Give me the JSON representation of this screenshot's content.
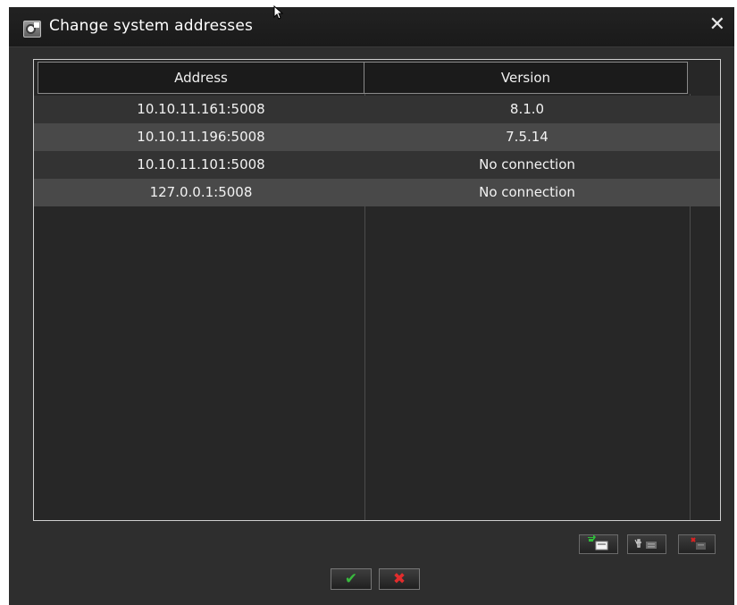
{
  "dialog": {
    "title": "Change system addresses",
    "close_glyph": "✕"
  },
  "table": {
    "columns": [
      "Address",
      "Version"
    ],
    "rows": [
      {
        "address": "10.10.11.161:5008",
        "version": "8.1.0"
      },
      {
        "address": "10.10.11.196:5008",
        "version": "7.5.14"
      },
      {
        "address": "10.10.11.101:5008",
        "version": "No connection"
      },
      {
        "address": "127.0.0.1:5008",
        "version": "No connection"
      }
    ]
  },
  "toolbar": {
    "add_icon": "add-address-icon",
    "edit_icon": "edit-address-icon",
    "delete_icon": "delete-address-icon"
  },
  "actions": {
    "ok_glyph": "✔",
    "cancel_glyph": "✖"
  },
  "colors": {
    "dialog_bg": "#2e2e2e",
    "row_alt": "#494949",
    "ok_green": "#39b93e",
    "cancel_red": "#e22c2c"
  }
}
